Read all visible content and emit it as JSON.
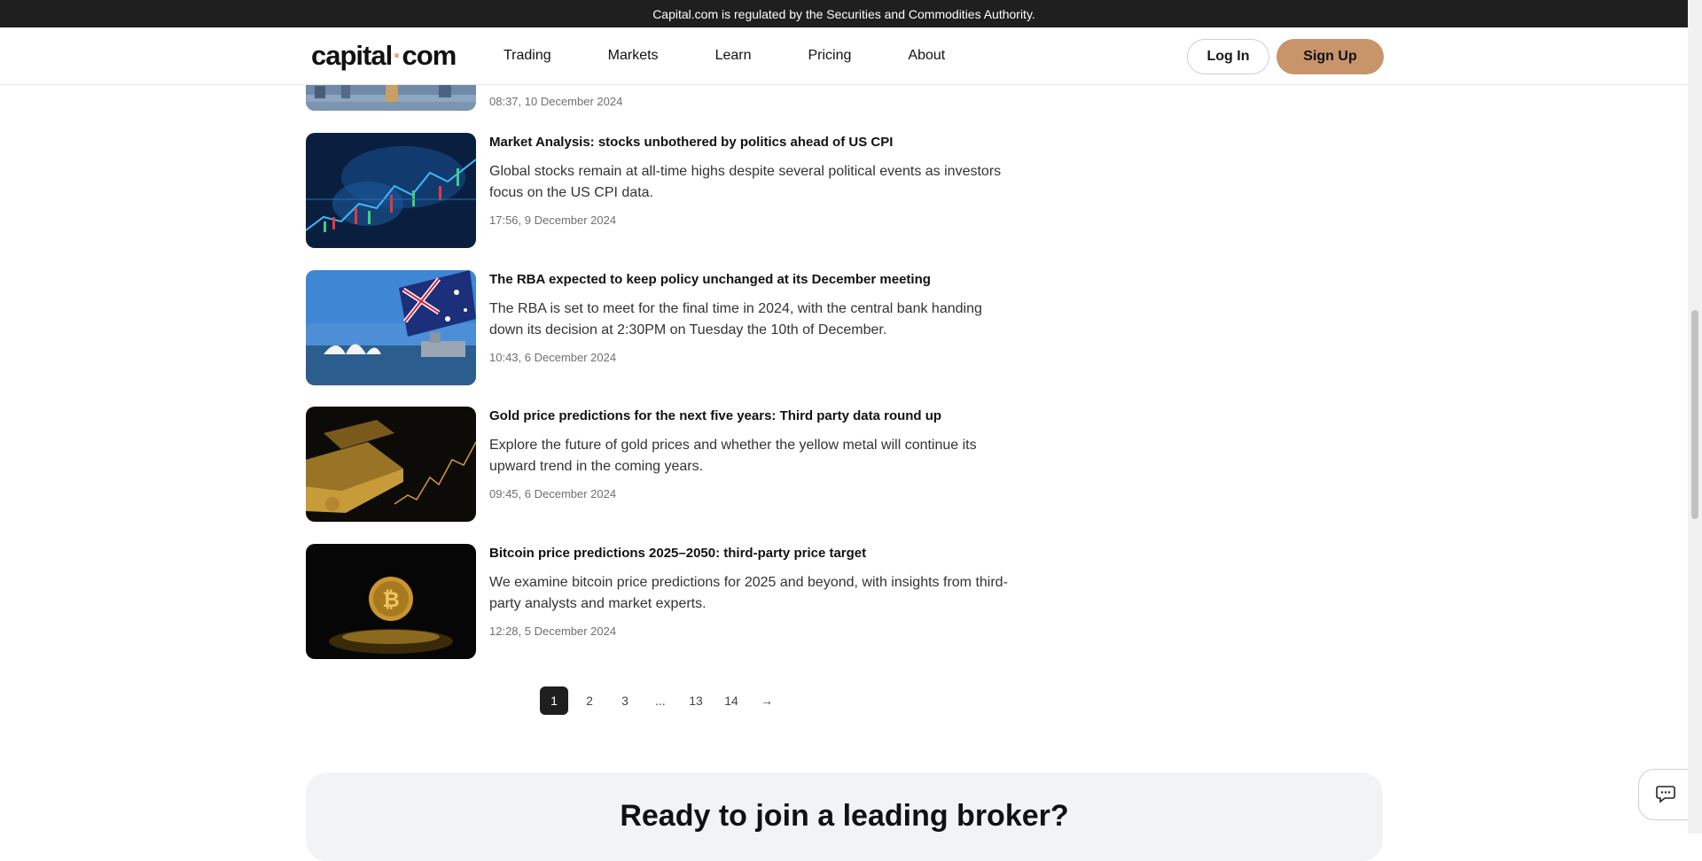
{
  "banner": {
    "text": "Capital.com is regulated by the Securities and Commodities Authority."
  },
  "header": {
    "logo_left": "capital",
    "logo_dot": "·",
    "logo_right": "com",
    "nav": [
      "Trading",
      "Markets",
      "Learn",
      "Pricing",
      "About"
    ],
    "login_label": "Log In",
    "signup_label": "Sign Up"
  },
  "partial_article": {
    "time": "08:37, 10 December 2024"
  },
  "articles": [
    {
      "title": "Market Analysis: stocks unbothered by politics ahead of US CPI",
      "desc": "Global stocks remain at all-time highs despite several political events as investors focus on the US CPI data.",
      "time": "17:56, 9 December 2024",
      "image": "stock-chart-image"
    },
    {
      "title": "The RBA expected to keep policy unchanged at its December meeting",
      "desc": "The RBA is set to meet for the final time in 2024, with the central bank handing down its decision at 2:30PM on Tuesday the 10th of December.",
      "time": "10:43, 6 December 2024",
      "image": "australia-flag-sydney-image"
    },
    {
      "title": "Gold price predictions for the next five years: Third party data round up",
      "desc": "Explore the future of gold prices and whether the yellow metal will continue its upward trend in the coming years.",
      "time": "09:45, 6 December 2024",
      "image": "gold-bars-image"
    },
    {
      "title": "Bitcoin price predictions 2025–2050: third-party price target",
      "desc": "We examine bitcoin price predictions for 2025 and beyond, with insights from third-party analysts and market experts.",
      "time": "12:28, 5 December 2024",
      "image": "bitcoin-coin-image"
    }
  ],
  "pagination": {
    "pages": [
      "1",
      "2",
      "3",
      "...",
      "13",
      "14"
    ],
    "active": "1",
    "next_icon": "→"
  },
  "cta": {
    "title": "Ready to join a leading broker?"
  },
  "chat": {
    "icon": "chat-icon"
  },
  "colors": {
    "accent": "#c8956b",
    "banner_bg": "#1f1f1f",
    "cta_bg": "#f2f3f4"
  }
}
